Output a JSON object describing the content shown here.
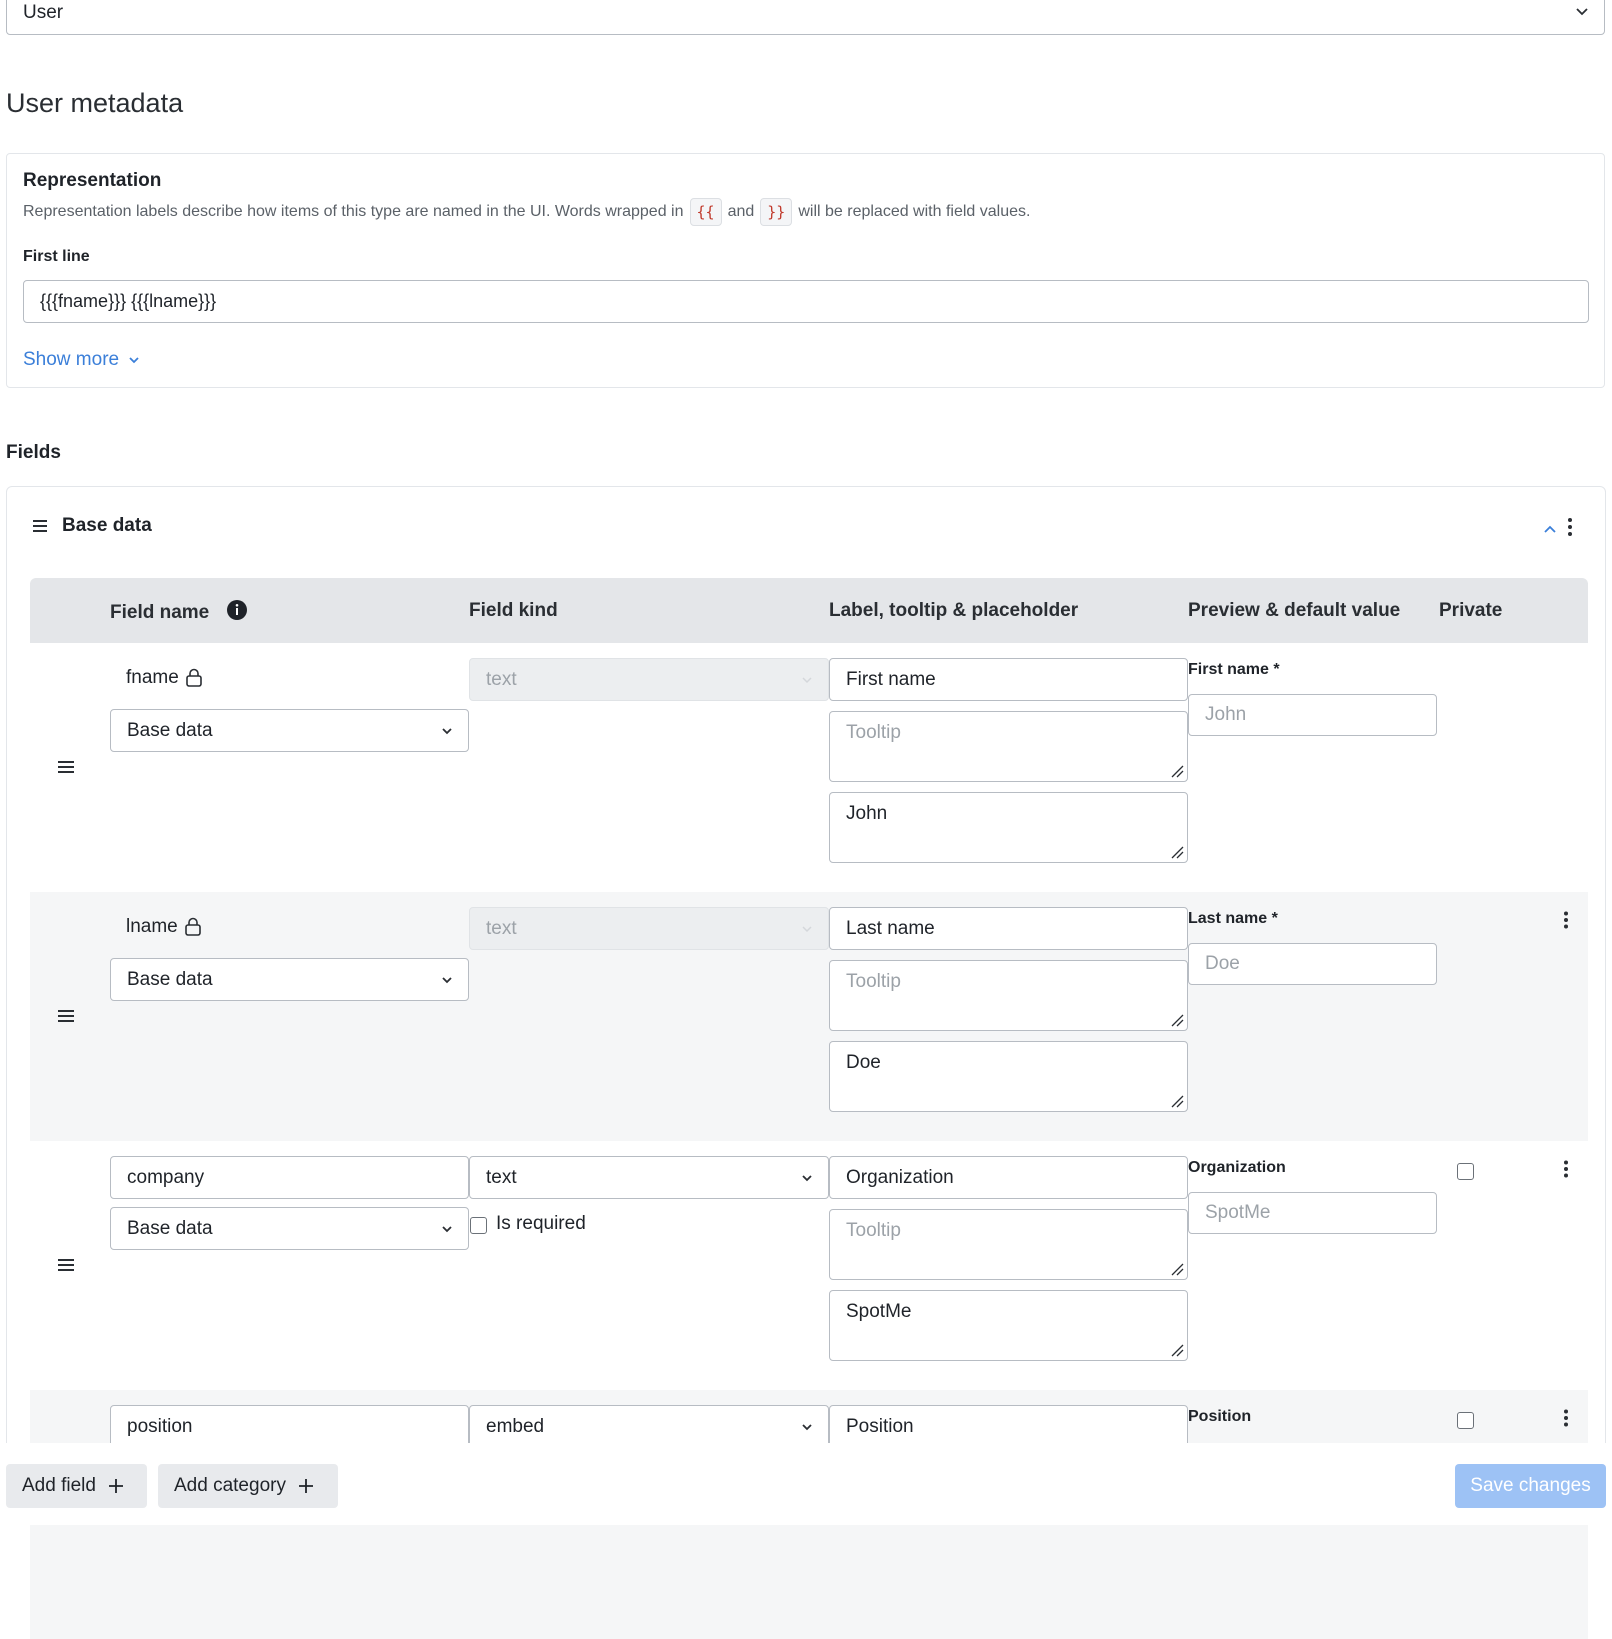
{
  "type_select": {
    "value": "User"
  },
  "page_title": "User metadata",
  "representation": {
    "title": "Representation",
    "desc_before": "Representation labels describe how items of this type are named in the UI. Words wrapped in",
    "open_token": "{{",
    "desc_and": "and",
    "close_token": "}}",
    "desc_after": "will be replaced with field values.",
    "first_line_label": "First line",
    "first_line_value": "{{{fname}}} {{{lname}}}",
    "show_more": "Show more"
  },
  "fields_heading": "Fields",
  "category": {
    "title": "Base data"
  },
  "table_headers": {
    "field_name": "Field name",
    "field_kind": "Field kind",
    "label_tooltip": "Label, tooltip & placeholder",
    "preview": "Preview & default value",
    "private": "Private"
  },
  "rows": [
    {
      "name": "fname",
      "locked": true,
      "category": "Base data",
      "kind": "text",
      "kind_disabled": true,
      "label": "First name",
      "tooltip_placeholder": "Tooltip",
      "placeholder": "John",
      "preview_label": "First name *",
      "preview_placeholder": "John"
    },
    {
      "name": "lname",
      "locked": true,
      "category": "Base data",
      "kind": "text",
      "kind_disabled": true,
      "label": "Last name",
      "tooltip_placeholder": "Tooltip",
      "placeholder": "Doe",
      "preview_label": "Last name *",
      "preview_placeholder": "Doe"
    },
    {
      "name": "company",
      "locked": false,
      "category": "Base data",
      "kind": "text",
      "kind_disabled": false,
      "is_required_label": "Is required",
      "label": "Organization",
      "tooltip_placeholder": "Tooltip",
      "placeholder": "SpotMe",
      "preview_label": "Organization",
      "preview_placeholder": "SpotMe"
    },
    {
      "name": "position",
      "locked": false,
      "kind": "embed",
      "kind_disabled": false,
      "label": "Position",
      "preview_label": "Position"
    }
  ],
  "actions": {
    "add_field": "Add field",
    "add_category": "Add category",
    "save": "Save changes"
  },
  "colors": {
    "accent": "#3b7fd9",
    "save_disabled": "#9dc2f5",
    "header_bg": "#e4e6e9",
    "row_shade": "#f5f6f7"
  }
}
